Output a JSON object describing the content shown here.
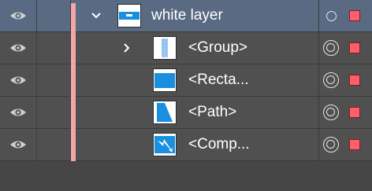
{
  "colors": {
    "panel_bg": "#505050",
    "selected_row_bg": "#5a6a82",
    "layer_color": "#f4a6a6",
    "selection_square": "#ff5f6d"
  },
  "layers": [
    {
      "name": "white layer",
      "expanded": true,
      "selected": true,
      "thumbnail": "layer-thumbnail-icon"
    },
    {
      "name": "<Group>",
      "expanded": false,
      "thumbnail": "group-thumbnail-icon"
    },
    {
      "name": "<Recta...",
      "thumbnail": "rectangle-thumbnail-icon"
    },
    {
      "name": "<Path>",
      "thumbnail": "path-thumbnail-icon"
    },
    {
      "name": "<Comp...",
      "thumbnail": "compound-path-thumbnail-icon"
    }
  ]
}
